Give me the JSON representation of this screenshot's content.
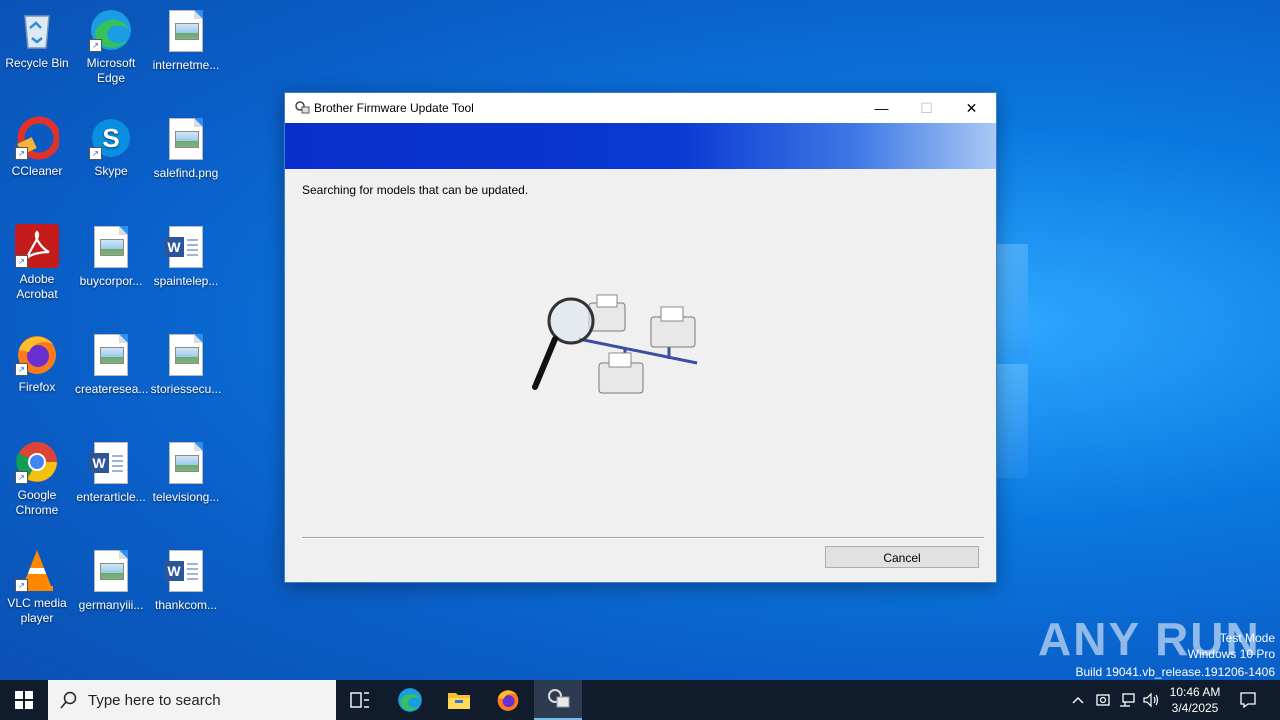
{
  "desktop": {
    "icons": [
      {
        "label": "Recycle Bin",
        "icon": "recycle-bin-icon"
      },
      {
        "label": "Microsoft Edge",
        "icon": "edge-icon"
      },
      {
        "label": "internetme...",
        "icon": "image-file-icon"
      },
      {
        "label": "CCleaner",
        "icon": "ccleaner-icon"
      },
      {
        "label": "Skype",
        "icon": "skype-icon"
      },
      {
        "label": "salefind.png",
        "icon": "image-file-icon"
      },
      {
        "label": "Adobe Acrobat",
        "icon": "acrobat-icon"
      },
      {
        "label": "buycorpor...",
        "icon": "image-file-icon"
      },
      {
        "label": "spaintelep...",
        "icon": "word-file-icon"
      },
      {
        "label": "Firefox",
        "icon": "firefox-icon"
      },
      {
        "label": "createresea...",
        "icon": "image-file-icon"
      },
      {
        "label": "storiessecu...",
        "icon": "image-file-icon"
      },
      {
        "label": "Google Chrome",
        "icon": "chrome-icon"
      },
      {
        "label": "enterarticle...",
        "icon": "word-file-icon"
      },
      {
        "label": "televisiong...",
        "icon": "image-file-icon"
      },
      {
        "label": "VLC media player",
        "icon": "vlc-icon"
      },
      {
        "label": "germanyiii...",
        "icon": "image-file-icon"
      },
      {
        "label": "thankcom...",
        "icon": "word-file-icon"
      }
    ]
  },
  "dialog": {
    "title": "Brother Firmware Update Tool",
    "status_text": "Searching for models that can be updated.",
    "cancel_label": "Cancel",
    "minimize_glyph": "—",
    "maximize_glyph": "☐",
    "close_glyph": "✕"
  },
  "taskbar": {
    "search_placeholder": "Type here to search",
    "time": "10:46 AM",
    "date": "3/4/2025"
  },
  "watermark": {
    "line1": "Test Mode",
    "line2": "Windows 10 Pro",
    "line3": "Build 19041.vb_release.191206-1406",
    "brand": "ANY RUN"
  },
  "colors": {
    "banner_start": "#0a2ecb",
    "banner_end": "#a9c8f4",
    "taskbar": "#101c2c",
    "desktop": "#0a78e0"
  }
}
